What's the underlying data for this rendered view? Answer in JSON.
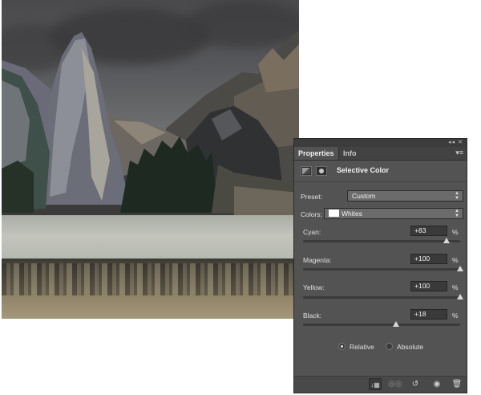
{
  "panel": {
    "tabs": [
      {
        "label": "Properties"
      },
      {
        "label": "Info"
      }
    ],
    "title": "Selective Color",
    "preset": {
      "label": "Preset:",
      "value": "Custom"
    },
    "colors": {
      "label": "Colors:",
      "value": "Whites",
      "swatch": "#ffffff"
    },
    "sliders": [
      {
        "label": "Cyan:",
        "display": "+83",
        "unit": "%",
        "value": 83
      },
      {
        "label": "Magenta:",
        "display": "+100",
        "unit": "%",
        "value": 100
      },
      {
        "label": "Yellow:",
        "display": "+100",
        "unit": "%",
        "value": 100
      },
      {
        "label": "Black:",
        "display": "+18",
        "unit": "%",
        "value": 18
      }
    ],
    "method": {
      "options": [
        {
          "label": "Relative",
          "selected": true
        },
        {
          "label": "Absolute",
          "selected": false
        }
      ]
    },
    "footer_icons": [
      "clip-to-layer-icon",
      "view-previous-state-icon",
      "reset-icon",
      "visibility-eye-icon",
      "trash-icon"
    ]
  },
  "colors": {
    "panel_bg": "#535353",
    "panel_dark": "#3c3c3c",
    "text": "#e6e6e6"
  }
}
